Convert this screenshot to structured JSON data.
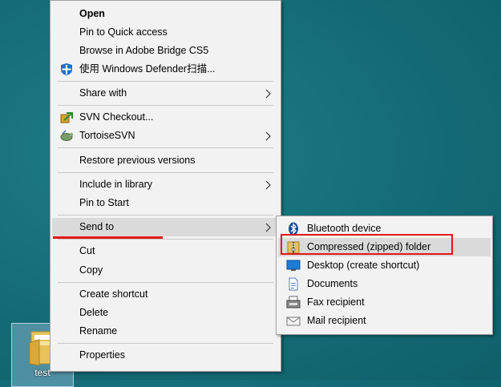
{
  "context_menu": {
    "items": [
      {
        "label": "Open"
      },
      {
        "label": "Pin to Quick access"
      },
      {
        "label": "Browse in Adobe Bridge CS5"
      },
      {
        "label": "使用 Windows Defender扫描...",
        "icon": "windows-defender-icon"
      },
      {
        "label": "Share with"
      },
      {
        "label": "SVN Checkout...",
        "icon": "svn-checkout-icon"
      },
      {
        "label": "TortoiseSVN",
        "icon": "tortoisesvn-icon"
      },
      {
        "label": "Restore previous versions"
      },
      {
        "label": "Include in library"
      },
      {
        "label": "Pin to Start"
      },
      {
        "label": "Send to"
      },
      {
        "label": "Cut"
      },
      {
        "label": "Copy"
      },
      {
        "label": "Create shortcut"
      },
      {
        "label": "Delete"
      },
      {
        "label": "Rename"
      },
      {
        "label": "Properties"
      }
    ]
  },
  "send_to_menu": {
    "items": [
      {
        "label": "Bluetooth device",
        "icon": "bluetooth-icon"
      },
      {
        "label": "Compressed (zipped) folder",
        "icon": "zip-folder-icon"
      },
      {
        "label": "Desktop (create shortcut)",
        "icon": "desktop-icon"
      },
      {
        "label": "Documents",
        "icon": "documents-icon"
      },
      {
        "label": "Fax recipient",
        "icon": "fax-icon"
      },
      {
        "label": "Mail recipient",
        "icon": "mail-icon"
      }
    ]
  },
  "desktop": {
    "icon_label": "test"
  },
  "colors": {
    "highlight": "#dadada",
    "annotation_red": "#e01818",
    "desktop_teal": "#17707a"
  }
}
